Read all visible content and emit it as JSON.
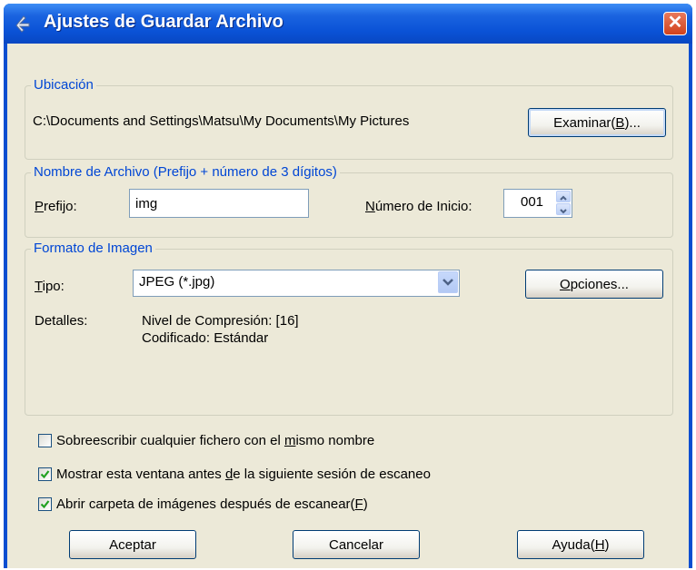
{
  "window": {
    "title": "Ajustes de Guardar Archivo",
    "close_glyph": "✕"
  },
  "location": {
    "group_title": "Ubicación",
    "path": "C:\\Documents and Settings\\Matsu\\My Documents\\My Pictures",
    "browse_label_pre": "Examinar(",
    "browse_label_key": "B",
    "browse_label_post": ")..."
  },
  "filename": {
    "group_title": "Nombre de Archivo (Prefijo + número de 3 dígitos)",
    "prefix_label_key": "P",
    "prefix_label_rest": "refijo:",
    "prefix_value": "img",
    "start_label_key": "N",
    "start_label_rest": "úmero de Inicio:",
    "start_value": "001"
  },
  "format": {
    "group_title": "Formato de Imagen",
    "type_label_key": "T",
    "type_label_rest": "ipo:",
    "type_value": "JPEG (*.jpg)",
    "options_label_key": "O",
    "options_label_rest": "pciones...",
    "details_label": "Detalles:",
    "details_line1": "Nivel de Compresión: [16]",
    "details_line2": "Codificado: Estándar"
  },
  "checkboxes": [
    {
      "pre": "Sobreescribir cualquier fichero con el ",
      "key": "m",
      "post": "ismo nombre",
      "checked": false
    },
    {
      "pre": "Mostrar esta ventana antes ",
      "key": "d",
      "post": "e la siguiente sesión de escaneo",
      "checked": true
    },
    {
      "pre": "Abrir carpeta de imágenes después de escanear(",
      "key": "F",
      "post": ")",
      "checked": true
    }
  ],
  "buttons": {
    "ok_label": "Aceptar",
    "cancel_label": "Cancelar",
    "help_label_pre": "Ayuda(",
    "help_label_key": "H",
    "help_label_post": ")"
  },
  "icons": {
    "title": "scanner-app-icon",
    "close": "close-icon",
    "combo_arrow": "chevron-down-icon",
    "spin": "spin-arrows-icon",
    "check": "checkmark-icon"
  },
  "colors": {
    "titlebar": "#0a52d6",
    "dialog_bg": "#ece9d8",
    "group_title": "#0046d5",
    "close_button": "#d2421c"
  }
}
